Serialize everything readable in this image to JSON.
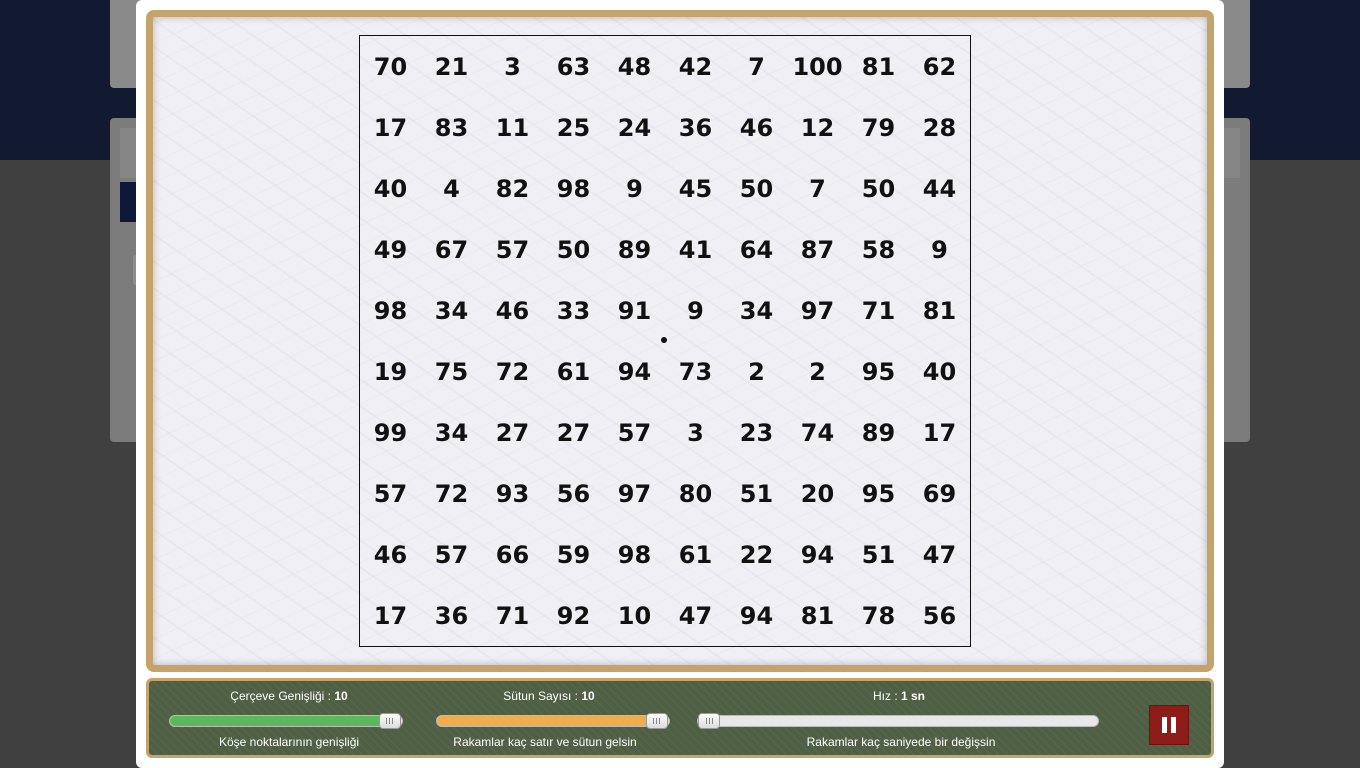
{
  "board": {
    "rows": [
      [
        "70",
        "21",
        "3",
        "63",
        "48",
        "42",
        "7",
        "100",
        "81",
        "62"
      ],
      [
        "17",
        "83",
        "11",
        "25",
        "24",
        "36",
        "46",
        "12",
        "79",
        "28"
      ],
      [
        "40",
        "4",
        "82",
        "98",
        "9",
        "45",
        "50",
        "7",
        "50",
        "44"
      ],
      [
        "49",
        "67",
        "57",
        "50",
        "89",
        "41",
        "64",
        "87",
        "58",
        "9"
      ],
      [
        "98",
        "34",
        "46",
        "33",
        "91",
        "9",
        "34",
        "97",
        "71",
        "81"
      ],
      [
        "19",
        "75",
        "72",
        "61",
        "94",
        "73",
        "2",
        "2",
        "95",
        "40"
      ],
      [
        "99",
        "34",
        "27",
        "27",
        "57",
        "3",
        "23",
        "74",
        "89",
        "17"
      ],
      [
        "57",
        "72",
        "93",
        "56",
        "97",
        "80",
        "51",
        "20",
        "95",
        "69"
      ],
      [
        "46",
        "57",
        "66",
        "59",
        "98",
        "61",
        "22",
        "94",
        "51",
        "47"
      ],
      [
        "17",
        "36",
        "71",
        "92",
        "10",
        "47",
        "94",
        "81",
        "78",
        "56"
      ]
    ]
  },
  "controls": {
    "frame_width": {
      "title": "Çerçeve Genişliği : ",
      "value": "10",
      "description": "Köşe noktalarının genişliği",
      "fill_fraction": 0.94,
      "color": "#5cb85c"
    },
    "column_count": {
      "title": "Sütun Sayısı : ",
      "value": "10",
      "description": "Rakamlar kaç satır ve sütun gelsin",
      "fill_fraction": 0.94,
      "color": "#f0ad4e"
    },
    "speed": {
      "title": "Hız : ",
      "value": "1 sn",
      "description": "Rakamlar kaç saniyede bir değişsin",
      "fill_fraction": 0.0
    },
    "pause_icon": "pause-icon",
    "pause_color": "#8e1c18"
  }
}
